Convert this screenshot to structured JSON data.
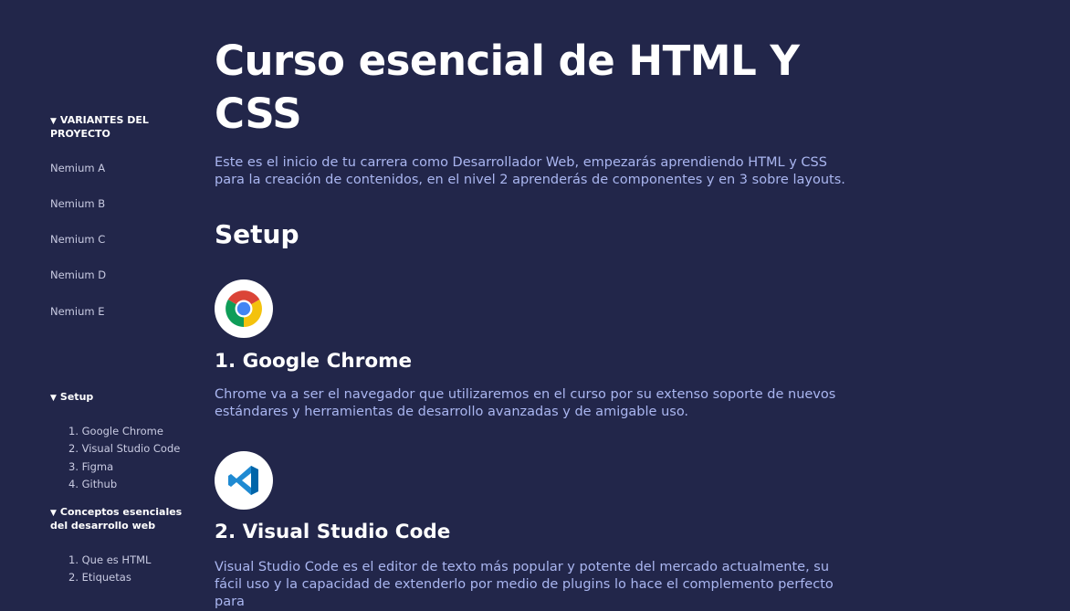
{
  "sidebar": {
    "variants_heading": "VARIANTES DEL PROYECTO",
    "variants": [
      "Nemium A",
      "Nemium B",
      "Nemium C",
      "Nemium D",
      "Nemium E"
    ],
    "setup_heading": "Setup",
    "setup_items": [
      "1. Google Chrome",
      "2. Visual Studio Code",
      "3. Figma",
      "4. Github"
    ],
    "concepts_heading": "Conceptos esenciales del desarrollo web",
    "concepts_items": [
      "1. Que es HTML",
      "2. Etiquetas"
    ]
  },
  "main": {
    "title": "Curso esencial de HTML Y CSS",
    "intro": "Este es el inicio de tu carrera como Desarrollador Web, empezarás aprendiendo HTML y CSS para la creación de contenidos, en el nivel 2 aprenderás de componentes y en 3 sobre layouts.",
    "setup_heading": "Setup",
    "tools": [
      {
        "icon": "chrome-icon",
        "title": "1. Google Chrome",
        "description": "Chrome va a ser el navegador que utilizaremos en el curso por su extenso soporte de nuevos estándares y herramientas de desarrollo avanzadas y de amigable uso."
      },
      {
        "icon": "vscode-icon",
        "title": "2. Visual Studio Code",
        "description": "Visual Studio Code es el editor de texto más popular y potente del mercado actualmente, su fácil uso y la capacidad de extenderlo por medio de plugins lo hace el complemento perfecto para"
      }
    ]
  },
  "colors": {
    "background": "#22264a",
    "body_text": "#aab6f0",
    "sidebar_text": "#c9cbe2"
  }
}
